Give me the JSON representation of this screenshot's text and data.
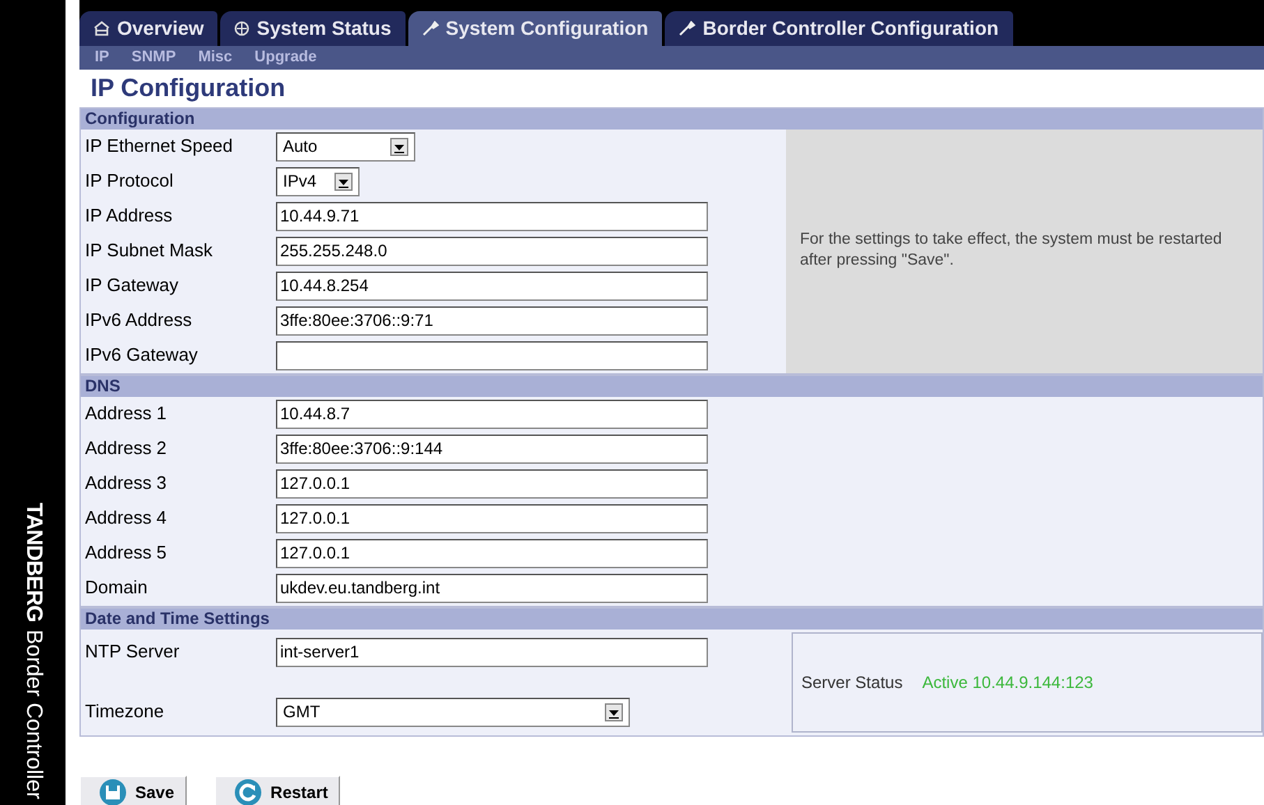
{
  "brand": {
    "name": "TANDBERG",
    "product": "Border Controller"
  },
  "tabs": [
    {
      "label": "Overview",
      "selected": false
    },
    {
      "label": "System Status",
      "selected": false
    },
    {
      "label": "System Configuration",
      "selected": true
    },
    {
      "label": "Border Controller Configuration",
      "selected": false
    }
  ],
  "subnav": [
    "IP",
    "SNMP",
    "Misc",
    "Upgrade"
  ],
  "title": "IP Configuration",
  "sections": [
    {
      "heading": "Configuration",
      "note": "For the settings to take effect, the system must be restarted after pressing \"Save\".",
      "fields": [
        {
          "label": "IP Ethernet Speed",
          "kind": "select",
          "value": "Auto"
        },
        {
          "label": "IP Protocol",
          "kind": "select",
          "value": "IPv4"
        },
        {
          "label": "IP Address",
          "kind": "text",
          "value": "10.44.9.71"
        },
        {
          "label": "IP Subnet Mask",
          "kind": "text",
          "value": "255.255.248.0"
        },
        {
          "label": "IP Gateway",
          "kind": "text",
          "value": "10.44.8.254"
        },
        {
          "label": "IPv6 Address",
          "kind": "text",
          "value": "3ffe:80ee:3706::9:71"
        },
        {
          "label": "IPv6 Gateway",
          "kind": "text"
        }
      ]
    },
    {
      "heading": "DNS",
      "fields": [
        {
          "label": "Address 1",
          "kind": "text",
          "value": "10.44.8.7"
        },
        {
          "label": "Address 2",
          "kind": "text",
          "value": "3ffe:80ee:3706::9:144"
        },
        {
          "label": "Address 3",
          "kind": "text",
          "value": "127.0.0.1"
        },
        {
          "label": "Address 4",
          "kind": "text",
          "value": "127.0.0.1"
        },
        {
          "label": "Address 5",
          "kind": "text",
          "value": "127.0.0.1"
        },
        {
          "label": "Domain",
          "kind": "text",
          "value": "ukdev.eu.tandberg.int"
        }
      ]
    },
    {
      "heading": "Date and Time Settings",
      "status": {
        "label": "Server Status",
        "value": "Active 10.44.9.144:123"
      },
      "fields": [
        {
          "label": "NTP Server",
          "kind": "text",
          "value": "int-server1"
        },
        {
          "label": "Timezone",
          "kind": "select",
          "value": "GMT"
        }
      ]
    }
  ],
  "buttons": [
    {
      "label": "Save"
    },
    {
      "label": "Restart"
    }
  ]
}
